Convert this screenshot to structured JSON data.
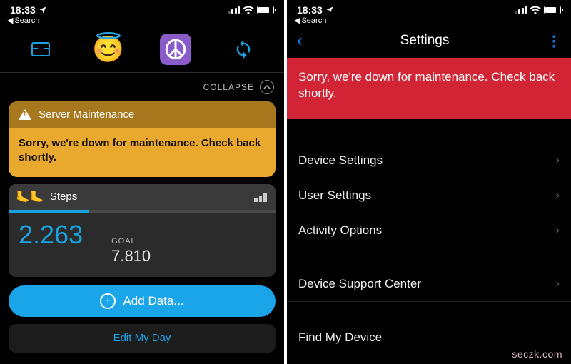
{
  "status": {
    "time": "18:33",
    "back_label": "Search"
  },
  "left": {
    "collapse_label": "COLLAPSE",
    "alert": {
      "title": "Server Maintenance",
      "message": "Sorry, we're down for maintenance. Check back shortly."
    },
    "steps": {
      "title": "Steps",
      "value": "2.263",
      "goal_label": "GOAL",
      "goal_value": "7.810"
    },
    "add_label": "Add Data...",
    "edit_label": "Edit My Day"
  },
  "right": {
    "title": "Settings",
    "banner": "Sorry, we're down for maintenance. Check back shortly.",
    "rows": {
      "device_settings": "Device Settings",
      "user_settings": "User Settings",
      "activity_options": "Activity Options",
      "support_center": "Device Support Center",
      "find_device": "Find My Device"
    }
  },
  "watermark": "seczk.com"
}
